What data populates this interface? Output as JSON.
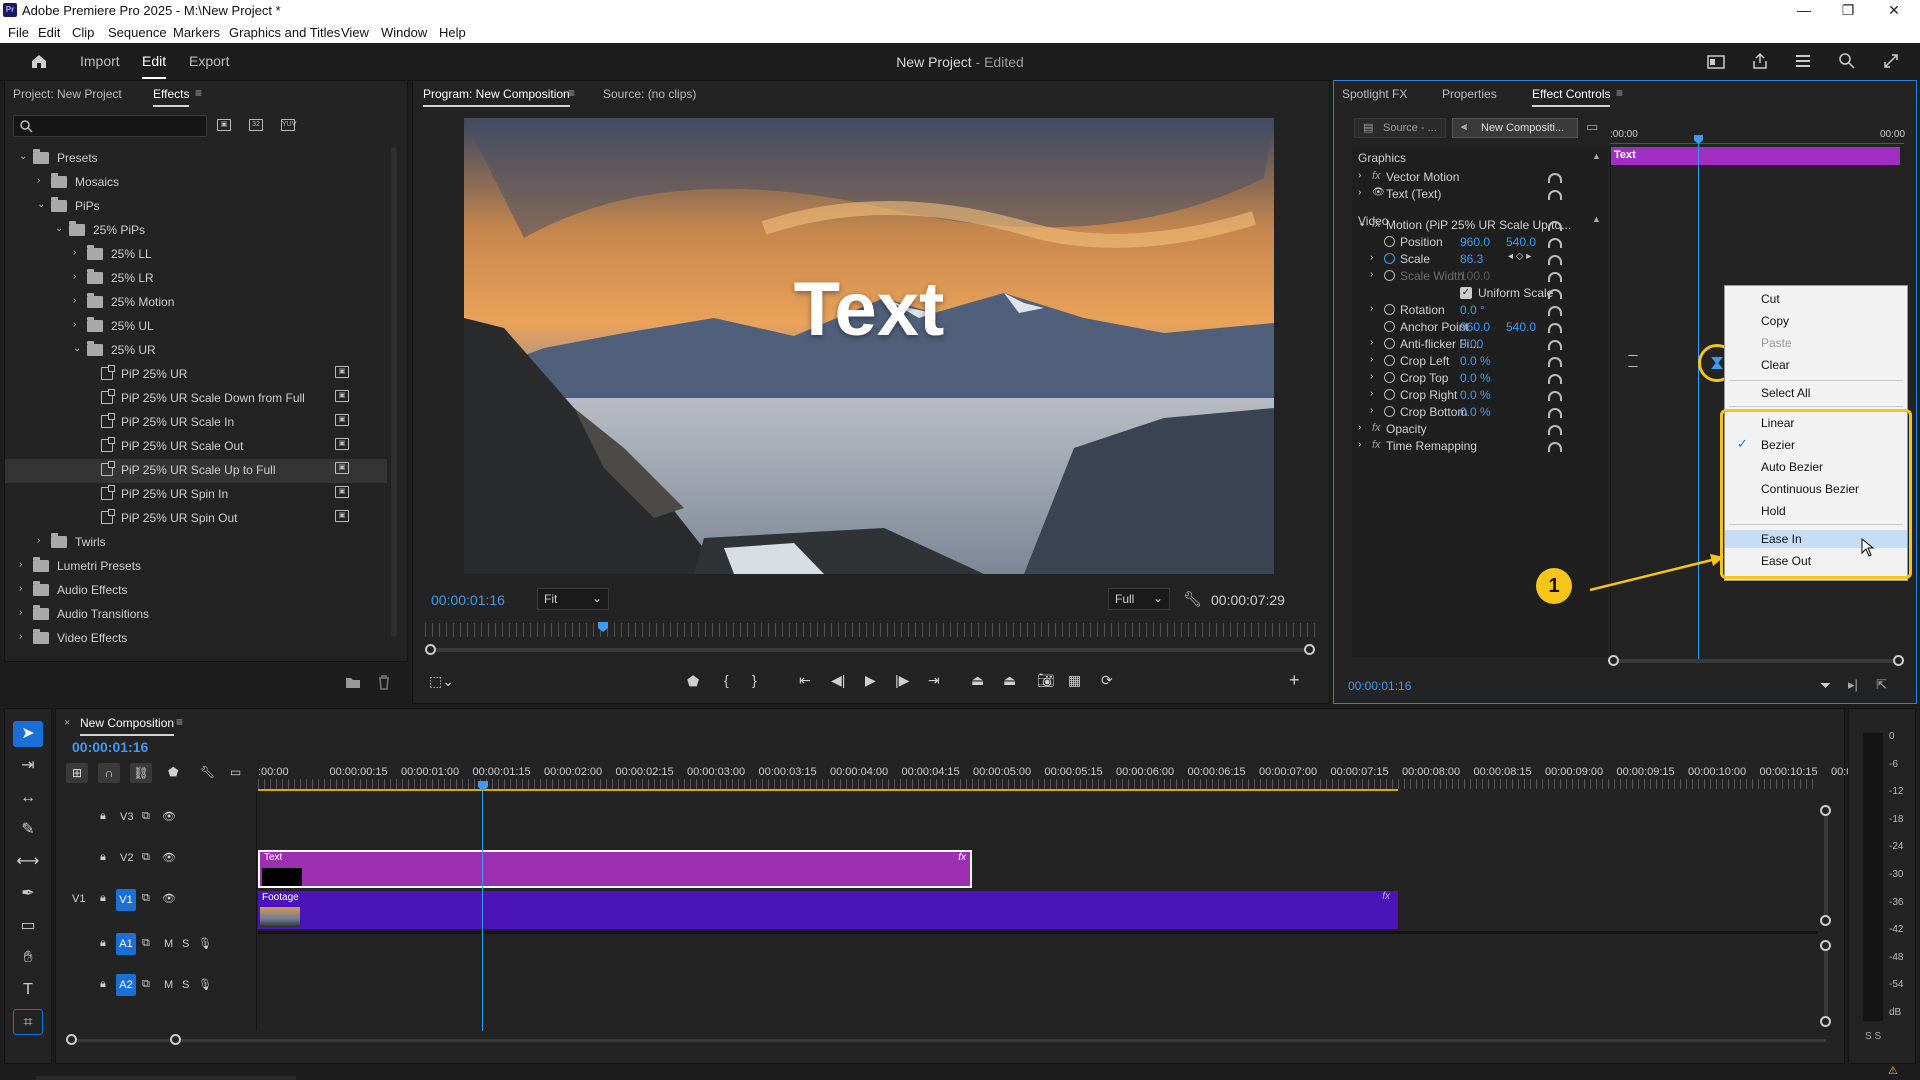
{
  "window": {
    "title": "Adobe Premiere Pro 2025 - M:\\New Project *",
    "controls": {
      "minimize": "—",
      "restore": "❐",
      "close": "✕"
    }
  },
  "menubar": [
    "File",
    "Edit",
    "Clip",
    "Sequence",
    "Markers",
    "Graphics and Titles",
    "View",
    "Window",
    "Help"
  ],
  "header": {
    "tabs": [
      "Import",
      "Edit",
      "Export"
    ],
    "active_tab": "Edit",
    "project_title": "New Project",
    "project_status": "- Edited"
  },
  "effects_panel": {
    "tabs": [
      "Project: New Project",
      "Effects"
    ],
    "search_placeholder": "",
    "tree": [
      {
        "label": "Presets",
        "level": 0,
        "type": "folder",
        "expanded": true
      },
      {
        "label": "Mosaics",
        "level": 1,
        "type": "folder",
        "expanded": false
      },
      {
        "label": "PiPs",
        "level": 1,
        "type": "folder",
        "expanded": true
      },
      {
        "label": "25% PiPs",
        "level": 2,
        "type": "folder",
        "expanded": true
      },
      {
        "label": "25% LL",
        "level": 3,
        "type": "folder",
        "expanded": false
      },
      {
        "label": "25% LR",
        "level": 3,
        "type": "folder",
        "expanded": false
      },
      {
        "label": "25% Motion",
        "level": 3,
        "type": "folder",
        "expanded": false
      },
      {
        "label": "25% UL",
        "level": 3,
        "type": "folder",
        "expanded": false
      },
      {
        "label": "25% UR",
        "level": 3,
        "type": "folder",
        "expanded": true
      },
      {
        "label": "PiP 25% UR",
        "level": 4,
        "type": "preset"
      },
      {
        "label": "PiP 25% UR Scale Down from Full",
        "level": 4,
        "type": "preset"
      },
      {
        "label": "PiP 25% UR Scale In",
        "level": 4,
        "type": "preset"
      },
      {
        "label": "PiP 25% UR Scale Out",
        "level": 4,
        "type": "preset"
      },
      {
        "label": "PiP 25% UR Scale Up to Full",
        "level": 4,
        "type": "preset",
        "selected": true
      },
      {
        "label": "PiP 25% UR Spin In",
        "level": 4,
        "type": "preset"
      },
      {
        "label": "PiP 25% UR Spin Out",
        "level": 4,
        "type": "preset"
      },
      {
        "label": "Twirls",
        "level": 1,
        "type": "folder",
        "expanded": false
      },
      {
        "label": "Lumetri Presets",
        "level": 0,
        "type": "folder",
        "expanded": false
      },
      {
        "label": "Audio Effects",
        "level": 0,
        "type": "folder",
        "expanded": false
      },
      {
        "label": "Audio Transitions",
        "level": 0,
        "type": "folder",
        "expanded": false
      },
      {
        "label": "Video Effects",
        "level": 0,
        "type": "folder",
        "expanded": false
      }
    ]
  },
  "program_monitor": {
    "tabs": [
      "Program: New Composition",
      "Source: (no clips)"
    ],
    "overlay_text": "Text",
    "timecode": "00:00:01:16",
    "zoom": "Fit",
    "quality": "Full",
    "duration": "00:00:07:29",
    "playhead_progress": 0.2
  },
  "effect_controls": {
    "tabs": [
      "Spotlight FX",
      "Properties",
      "Effect Controls"
    ],
    "source_tab": "Source - ...",
    "sequence_tab": "New Compositi...",
    "ruler_start": ":00:00",
    "ruler_end": "00:00",
    "clip_label": "Text",
    "sections": {
      "graphics": "Graphics",
      "video": "Video"
    },
    "rows": [
      {
        "label": "Vector Motion",
        "kind": "fx"
      },
      {
        "label": "Text (Text)",
        "kind": "eye"
      },
      {
        "label": "Motion (PiP 25% UR Scale Up to...",
        "kind": "fx-open"
      },
      {
        "label": "Position",
        "v1": "960.0",
        "v2": "540.0",
        "kind": "prop"
      },
      {
        "label": "Scale",
        "v1": "86.3",
        "kind": "prop-anim"
      },
      {
        "label": "Scale Width",
        "v1": "100.0",
        "kind": "prop-dim"
      },
      {
        "label": "Uniform Scale",
        "kind": "checkbox"
      },
      {
        "label": "Rotation",
        "v1": "0.0 °",
        "kind": "prop"
      },
      {
        "label": "Anchor Point",
        "v1": "960.0",
        "v2": "540.0",
        "kind": "prop"
      },
      {
        "label": "Anti-flicker Fi...",
        "v1": "0.00",
        "kind": "prop"
      },
      {
        "label": "Crop Left",
        "v1": "0.0 %",
        "kind": "prop"
      },
      {
        "label": "Crop Top",
        "v1": "0.0 %",
        "kind": "prop"
      },
      {
        "label": "Crop Right",
        "v1": "0.0 %",
        "kind": "prop"
      },
      {
        "label": "Crop Bottom",
        "v1": "0.0 %",
        "kind": "prop"
      },
      {
        "label": "Opacity",
        "kind": "fx"
      },
      {
        "label": "Time Remapping",
        "kind": "fx"
      }
    ],
    "timecode": "00:00:01:16"
  },
  "context_menu": {
    "items": [
      "Cut",
      "Copy",
      "Paste",
      "Clear",
      "Select All"
    ],
    "disabled": [
      "Paste"
    ],
    "interp_items": [
      "Linear",
      "Bezier",
      "Auto Bezier",
      "Continuous Bezier",
      "Hold",
      "Ease In",
      "Ease Out"
    ],
    "checked": "Bezier",
    "highlighted": "Ease In"
  },
  "callout": {
    "number": "1",
    "color": "#f5c518"
  },
  "timeline": {
    "sequence_name": "New Composition",
    "timecode": "00:00:01:16",
    "ruler": [
      ":00:00",
      "00:00:00:15",
      "00:00:01:00",
      "00:00:01:15",
      "00:00:02:00",
      "00:00:02:15",
      "00:00:03:00",
      "00:00:03:15",
      "00:00:04:00",
      "00:00:04:15",
      "00:00:05:00",
      "00:00:05:15",
      "00:00:06:00",
      "00:00:06:15",
      "00:00:07:00",
      "00:00:07:15",
      "00:00:08:00",
      "00:00:08:15",
      "00:00:09:00",
      "00:00:09:15",
      "00:00:10:00",
      "00:00:10:15",
      "00:00:"
    ],
    "tracks": [
      {
        "name": "V3",
        "type": "video"
      },
      {
        "name": "V2",
        "type": "video"
      },
      {
        "name": "V1",
        "type": "video",
        "source": "V1",
        "target": "V1"
      },
      {
        "name": "A1",
        "type": "audio",
        "target": "A1",
        "m": "M",
        "s": "S"
      },
      {
        "name": "A2",
        "type": "audio",
        "target": "A2",
        "m": "M",
        "s": "S"
      }
    ],
    "clips": [
      {
        "name": "Text",
        "track": "V2",
        "color": "#9d2fb3"
      },
      {
        "name": "Footage",
        "track": "V1",
        "color": "#4b14b8"
      }
    ],
    "fx_badge": "fx"
  },
  "audio_meter": {
    "labels": [
      "0",
      "-6",
      "-12",
      "-18",
      "-24",
      "-30",
      "-36",
      "-42",
      "-48",
      "-54",
      "dB"
    ],
    "footer": "S S"
  },
  "colors": {
    "accent": "#2f8ff0",
    "clip_text": "#9d2fb3",
    "clip_footage": "#4b14b8",
    "highlight_box": "#f5c518"
  }
}
